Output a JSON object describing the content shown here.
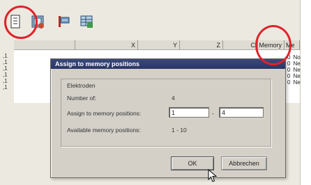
{
  "toolbar": {
    "icons": [
      "properties-icon",
      "chip-icon",
      "electrode-assign-icon",
      "table-icon"
    ]
  },
  "grid": {
    "columns": [
      "X",
      "Y",
      "Z",
      "C",
      "Memory",
      "Me"
    ],
    "left_cells": [
      ",1",
      ",1",
      ",1",
      ",1",
      ",1",
      ",1"
    ],
    "right_cells": [
      {
        "num": "0",
        "text": "No"
      },
      {
        "num": "0",
        "text": "Ne"
      },
      {
        "num": "0",
        "text": "Ne"
      },
      {
        "num": "0",
        "text": "Ne"
      },
      {
        "num": "0",
        "text": "Ne"
      }
    ]
  },
  "dialog": {
    "title": "Assign to memory positions",
    "group_label": "Elektroden",
    "number_label": "Number of:",
    "number_value": "4",
    "assign_label": "Assign to memory positions:",
    "from_value": "1",
    "separator": "-",
    "to_value": "4",
    "available_label": "Available memory positions:",
    "available_value": "1 - 10",
    "ok_label": "OK",
    "cancel_label": "Abbrechen"
  },
  "colors": {
    "highlight": "#e0222a",
    "titlebar": "#2a3566"
  }
}
